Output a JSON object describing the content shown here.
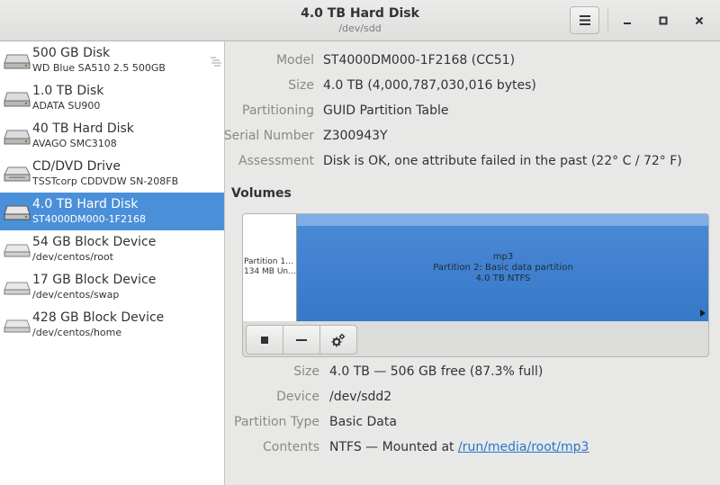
{
  "header": {
    "title": "4.0 TB Hard Disk",
    "subtitle": "/dev/sdd"
  },
  "window_controls": {
    "minimize": "–",
    "maximize": "□",
    "close": "×"
  },
  "sidebar": {
    "items": [
      {
        "name": "500 GB Disk",
        "desc": "WD Blue SA510 2.5 500GB",
        "icon": "hard-disk-icon",
        "selected": false
      },
      {
        "name": "1.0 TB Disk",
        "desc": "ADATA SU900",
        "icon": "hard-disk-icon",
        "selected": false
      },
      {
        "name": "40 TB Hard Disk",
        "desc": "AVAGO SMC3108",
        "icon": "hard-disk-icon",
        "selected": false
      },
      {
        "name": "CD/DVD Drive",
        "desc": "TSSTcorp CDDVDW SN-208FB",
        "icon": "optical-drive-icon",
        "selected": false
      },
      {
        "name": "4.0 TB Hard Disk",
        "desc": "ST4000DM000-1F2168",
        "icon": "hard-disk-icon",
        "selected": true
      },
      {
        "name": "54 GB Block Device",
        "desc": "/dev/centos/root",
        "icon": "block-device-icon",
        "selected": false
      },
      {
        "name": "17 GB Block Device",
        "desc": "/dev/centos/swap",
        "icon": "block-device-icon",
        "selected": false
      },
      {
        "name": "428 GB Block Device",
        "desc": "/dev/centos/home",
        "icon": "block-device-icon",
        "selected": false
      }
    ]
  },
  "disk": {
    "model_label": "Model",
    "model": "ST4000DM000-1F2168 (CC51)",
    "size_label": "Size",
    "size": "4.0 TB (4,000,787,030,016 bytes)",
    "partitioning_label": "Partitioning",
    "partitioning": "GUID Partition Table",
    "serial_label": "Serial Number",
    "serial": "Z300943Y",
    "assessment_label": "Assessment",
    "assessment": "Disk is OK, one attribute failed in the past (22° C / 72° F)"
  },
  "volumes": {
    "title": "Volumes",
    "partition1": {
      "line1": "Partition 1…",
      "line2": "134 MB Un…"
    },
    "partition2": {
      "line1": "mp3",
      "line2": "Partition 2: Basic data partition",
      "line3": "4.0 TB NTFS"
    }
  },
  "partition": {
    "size_label": "Size",
    "size": "4.0 TB — 506 GB free (87.3% full)",
    "device_label": "Device",
    "device": "/dev/sdd2",
    "type_label": "Partition Type",
    "type": "Basic Data",
    "contents_label": "Contents",
    "contents_prefix": "NTFS — Mounted at ",
    "contents_link": "/run/media/root/mp3"
  },
  "colors": {
    "selected": "#4a90d9",
    "partition_fill": "#3a7dcd",
    "link": "#2a76c6"
  }
}
